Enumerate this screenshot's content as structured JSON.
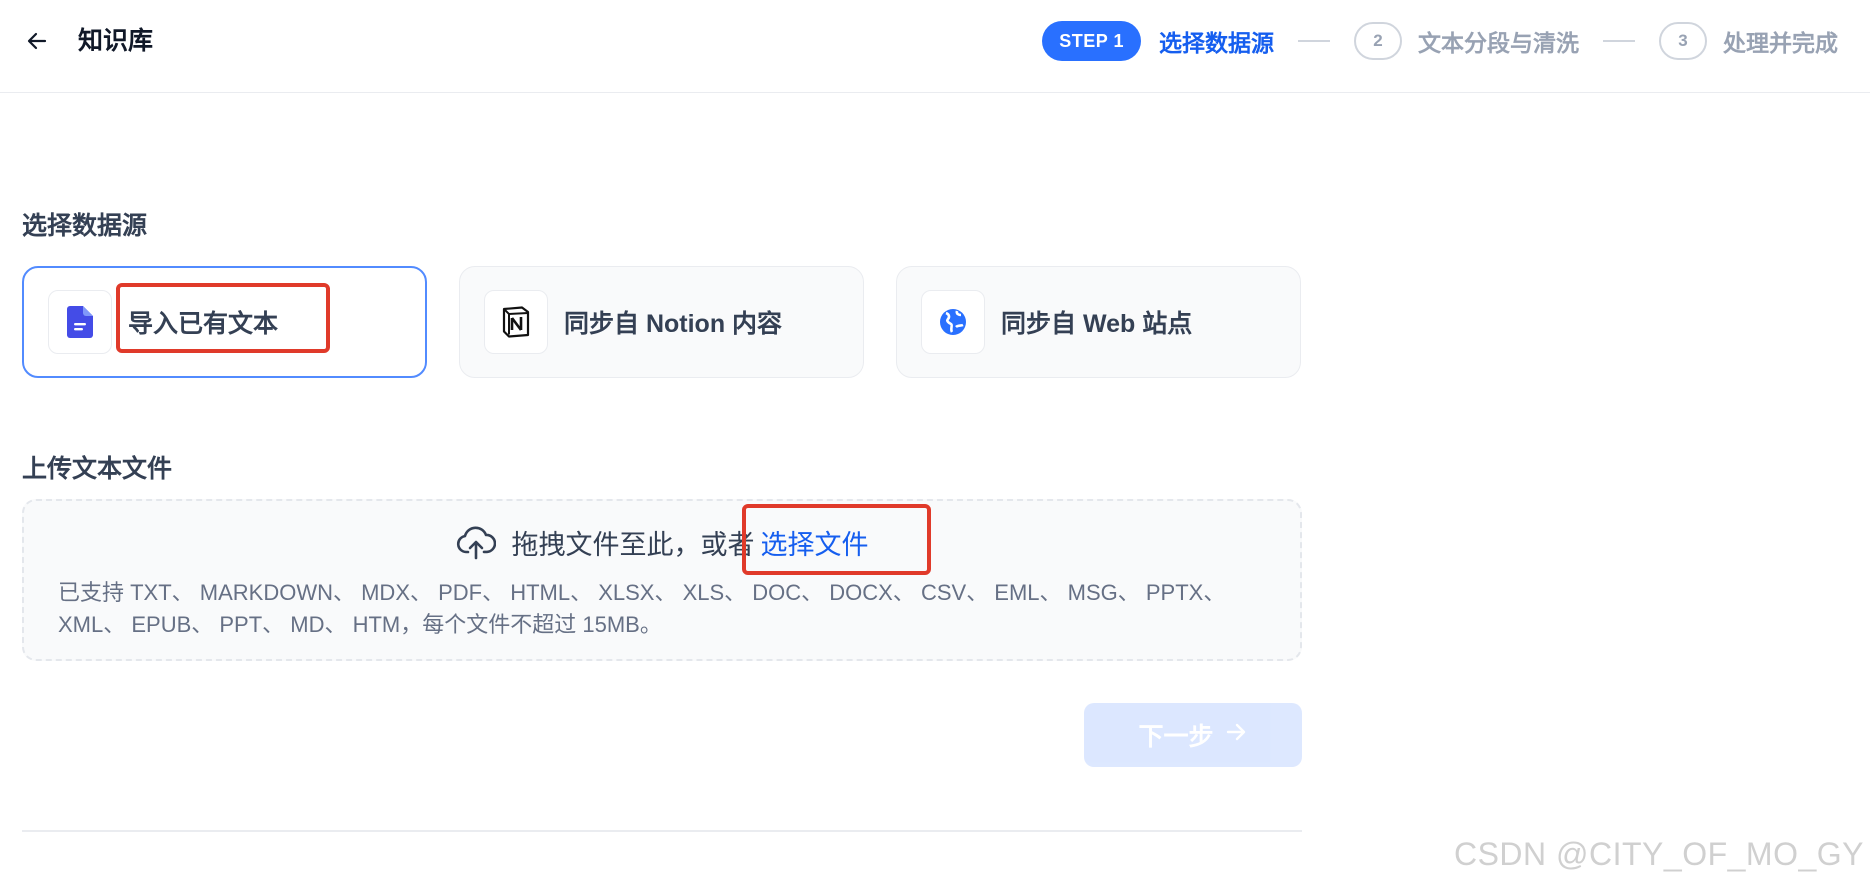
{
  "header": {
    "title": "知识库",
    "steps": [
      {
        "badge": "STEP 1",
        "label": "选择数据源",
        "active": true
      },
      {
        "badge": "2",
        "label": "文本分段与清洗",
        "active": false
      },
      {
        "badge": "3",
        "label": "处理并完成",
        "active": false
      }
    ]
  },
  "data_source": {
    "title": "选择数据源",
    "options": [
      {
        "label": "导入已有文本",
        "icon": "document-icon",
        "selected": true
      },
      {
        "label": "同步自 Notion 内容",
        "icon": "notion-icon",
        "selected": false
      },
      {
        "label": "同步自 Web 站点",
        "icon": "globe-icon",
        "selected": false
      }
    ]
  },
  "upload": {
    "title": "上传文本文件",
    "prompt": "拖拽文件至此，或者",
    "link": "选择文件",
    "icon": "cloud-upload-icon",
    "hint": "已支持 TXT、 MARKDOWN、 MDX、 PDF、 HTML、 XLSX、 XLS、 DOC、 DOCX、 CSV、 EML、 MSG、 PPTX、 XML、 EPUB、 PPT、 MD、 HTM，每个文件不超过 15MB。"
  },
  "next_button": {
    "label": "下一步",
    "enabled": false
  },
  "watermark": "CSDN @CITY_OF_MO_GY",
  "colors": {
    "accent": "#155eef",
    "step_badge": "#2970ff",
    "highlight": "#e03a2a",
    "document_icon": "#444ce7"
  }
}
